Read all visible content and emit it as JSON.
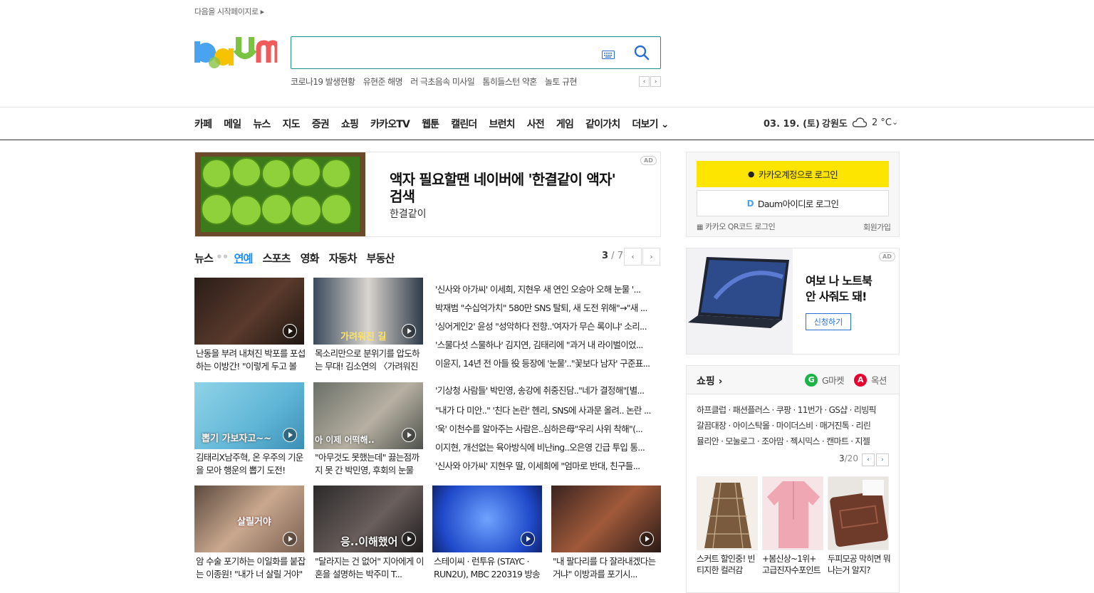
{
  "top": {
    "start_page": "다음을 시작페이지로 ▸"
  },
  "search": {
    "placeholder": "",
    "trends": [
      "코로나19 발생현황",
      "유현준 해명",
      "러 극초음속 미사일",
      "톰히들스턴 약혼",
      "놀토 규현"
    ]
  },
  "gnb": {
    "items": [
      "카페",
      "메일",
      "뉴스",
      "지도",
      "증권",
      "쇼핑",
      "카카오TV",
      "웹툰",
      "캘린더",
      "브런치",
      "사전",
      "게임",
      "같이가치",
      "더보기 ⌄"
    ],
    "date": "03. 19. (토)",
    "region": "강원도",
    "temp": "2 °C"
  },
  "ad1": {
    "badge": "AD",
    "title": "액자 필요할땐 네이버에 '한결같이 액자' 검색",
    "sub": "한결같이"
  },
  "news": {
    "tabs": [
      "뉴스",
      "연예",
      "스포츠",
      "영화",
      "자동차",
      "부동산"
    ],
    "page_current": "3",
    "page_total": " / 7",
    "thumbs": [
      {
        "caption": "난동을 부려 내쳐진 박포를 포섭하는 이방간! \"이렇게 두고 볼 것입니까\""
      },
      {
        "caption": "목소리만으로 분위기를 압도하는 무대! 김소연의 〈가려워진 길〉"
      },
      {
        "caption": "김태리X남주혁, 온 우주의 기운을 모아 행운의 뽑기 도전!"
      },
      {
        "caption": "\"아무것도 못했는데\" 끓는점까지 못 간 박민영, 후회의 눈물"
      },
      {
        "caption": "암 수술 포기하는 이일화를 붙잡는 이종원! \"내가 너 살릴 거야\""
      },
      {
        "caption": "\"달라지는 건 없어\" 지아에게 이혼을 설명하는 박주미 T..."
      },
      {
        "caption": "스테이씨 · 런투유 (STAYC · RUN2U), MBC 220319 방송"
      },
      {
        "caption": "\"내 팔다리를 다 잘라내겠다는 거냐\" 이방과를 포기시..."
      }
    ],
    "thumb_overlays": [
      "가려워진 길",
      "뽑기 가보자고~~",
      "아 이제 어떡해..",
      "살릴거야",
      "응..이해했어"
    ],
    "headlines_1": [
      "'신사와 아가씨' 이세희, 지현우 새 연인 오승아 오해 눈물 '...",
      "박재범 \"수십억가치\" 580만 SNS 탈퇴, 새 도전 위해\"→\"새 ...",
      "'싱어게인2' 윤성 \"성악하다 전향..'여자가 무슨 록이냐' 소리...",
      "'스물다섯 스물하나' 김지연, 김태리에 \"과거 내 라이벌이었...",
      "이윤지, 14년 전 아들 役 등장에 '눈물'..\"꽃보다 남자' 구준표..."
    ],
    "headlines_2": [
      "'기상청 사람들' 박민영, 송강에 취중진담..\"네가 결정해\"[별...",
      "\"내가 다 미안..\" '친다 논란' 헨리, SNS에 사과문 올려.. 논란 ...",
      "'욱' 이천수를 알아주는 사람은..심하은母\"우리 사위 착해\"(...",
      "이지현, 개선없는 육아방식에 비난ing..오은영 긴급 투입 통...",
      "'신사와 아가씨' 지현우 딸, 이세희에 \"엄마로 반대, 친구들..."
    ]
  },
  "login": {
    "kakao": "카카오계정으로 로그인",
    "daum": "Daum아이디로 로그인",
    "qr": "카카오 QR코드 로그인",
    "join": "회원가입"
  },
  "ad2": {
    "badge": "AD",
    "title_1": "여보 나 노트북",
    "title_2": "안 사줘도 돼!",
    "button": "신청하기"
  },
  "shopping": {
    "title": "쇼핑 ›",
    "brand1": "G마켓",
    "brand2": "옥션",
    "lines": [
      "하프클럽 · 패션플러스 · 쿠팡 · 11번가 · GS샵 · 리빙픽",
      "갈끔대장 · 아이스탁몰 · 마이더스비 · 매거진톡 · 리린",
      "뮬리안 · 모눌로그 · 조아맘 · 젝시믹스 · 캔마트 · 지젤"
    ],
    "page_current": "3",
    "page_total": "/20",
    "products": [
      {
        "caption": "스커트 할인중! 빈티지한 컬러감"
      },
      {
        "caption": "+봄신상~1위+ 고급진자수포인트"
      },
      {
        "caption": "두피모공 막히면 뭐나는거 알지?"
      }
    ]
  },
  "colors": {
    "accent": "#1a8cff",
    "kakao": "#fee500",
    "search_border": "#1c8c8c"
  }
}
